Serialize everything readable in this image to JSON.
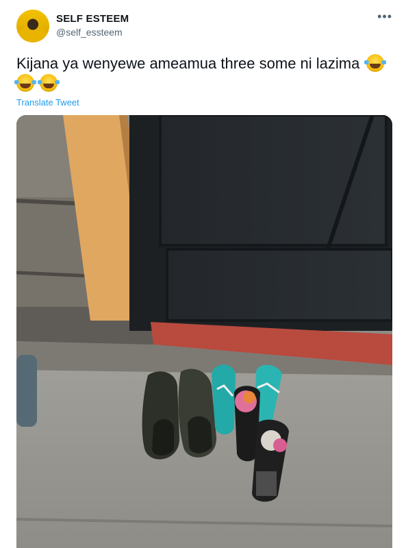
{
  "author": {
    "display_name": "SELF ESTEEM",
    "handle": "@self_essteem"
  },
  "tweet": {
    "text": "Kijana ya wenyewe ameamua three some ni lazima",
    "emojis": [
      "face-with-tears-of-joy",
      "face-with-tears-of-joy",
      "face-with-tears-of-joy"
    ],
    "translate_label": "Translate Tweet",
    "more_icon": "more-icon"
  },
  "photo": {
    "subject": "shoes-photo"
  },
  "colors": {
    "accent": "#1d9bf0",
    "secondary_text": "#536471",
    "primary_text": "#0f1419"
  }
}
